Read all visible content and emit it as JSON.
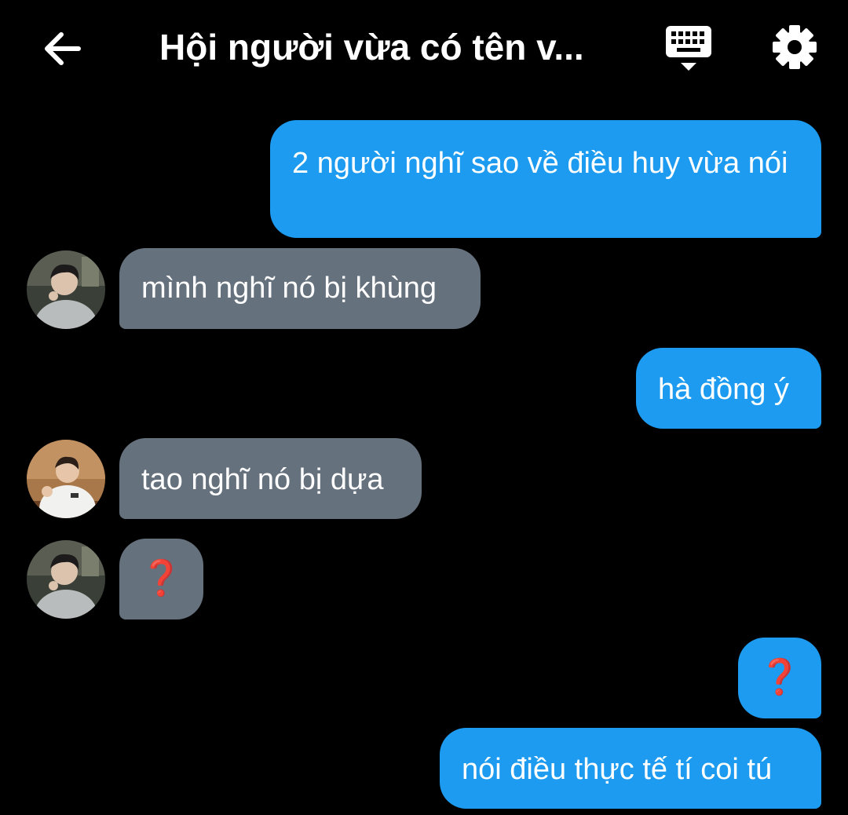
{
  "header": {
    "title": "Hội người vừa có tên v...",
    "back_icon": "arrow-left-icon",
    "keyboard_icon": "keyboard-icon",
    "settings_icon": "gear-icon"
  },
  "messages": [
    {
      "direction": "outgoing",
      "text": "2 người nghĩ sao về điều huy vừa nói"
    },
    {
      "direction": "incoming",
      "sender_avatar": "avatar-1",
      "text": "mình nghĩ nó bị khùng"
    },
    {
      "direction": "outgoing",
      "text": "hà đồng ý"
    },
    {
      "direction": "incoming",
      "sender_avatar": "avatar-2",
      "text": "tao nghĩ nó bị dựa"
    },
    {
      "direction": "incoming",
      "sender_avatar": "avatar-1",
      "text": "❓"
    },
    {
      "direction": "outgoing",
      "text": "❓"
    },
    {
      "direction": "outgoing",
      "text": "nói điều thực tế tí coi tú"
    }
  ],
  "colors": {
    "background": "#000000",
    "outgoing_bubble": "#1d9bf0",
    "incoming_bubble": "#66717e",
    "question_mark": "#e01a1a"
  }
}
